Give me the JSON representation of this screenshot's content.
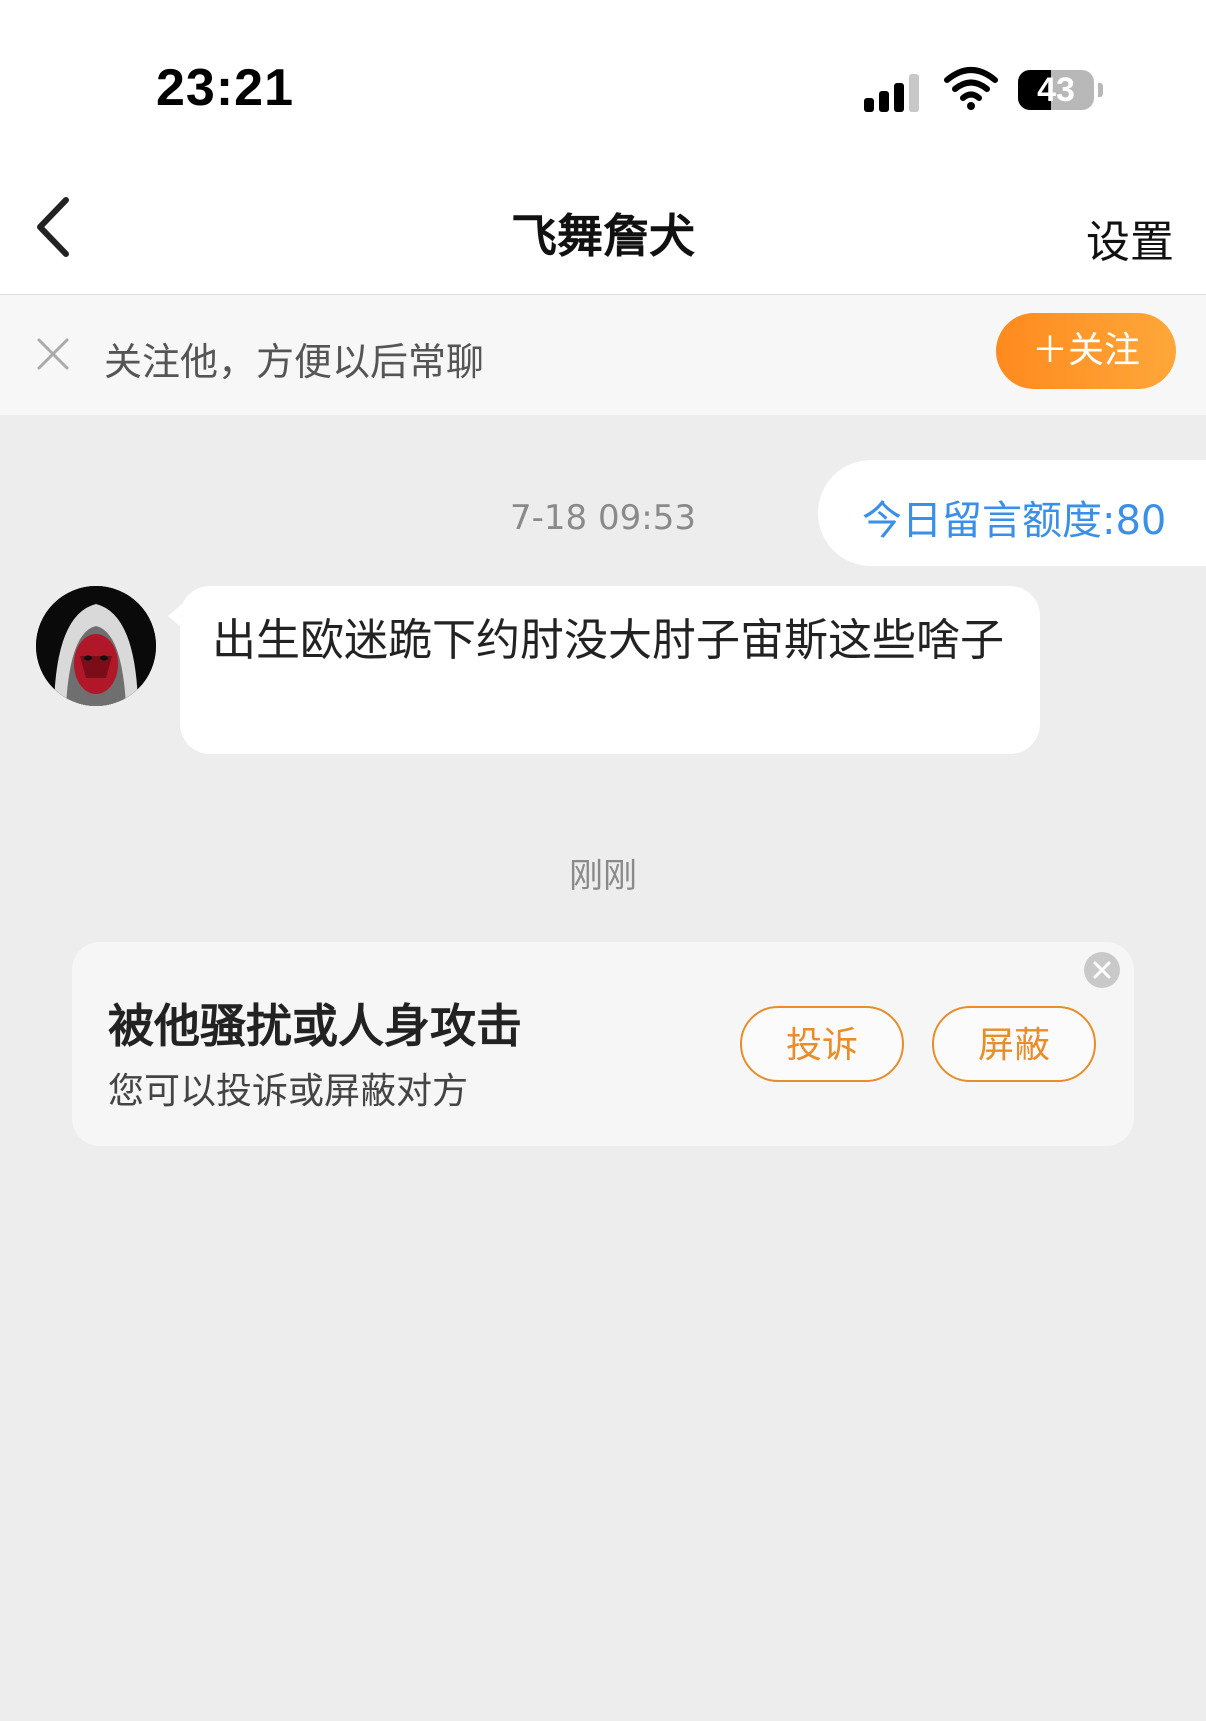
{
  "status_bar": {
    "time": "23:21",
    "signal_bars": 4,
    "wifi": "wifi-icon",
    "battery_level": "43"
  },
  "header": {
    "back_icon": "chevron-left-icon",
    "title": "飞舞詹犬",
    "settings_label": "设置"
  },
  "follow_bar": {
    "close_icon": "close-icon",
    "text": "关注他，方便以后常聊",
    "button_label": "＋关注",
    "accent_color": "#ff9a2e"
  },
  "messages": [
    {
      "timestamp": "7-18 09:53",
      "text": "出生欧迷跪下约肘没大肘子宙斯这些啥子",
      "avatar": "hooded-figure-avatar"
    }
  ],
  "quota_badge": "今日留言额度:80",
  "recent_time": "刚刚",
  "report_card": {
    "title": "被他骚扰或人身攻击",
    "subtitle": "您可以投诉或屏蔽对方",
    "complain_label": "投诉",
    "block_label": "屏蔽",
    "close_icon": "close-icon",
    "accent_color": "#e88d2a"
  },
  "colors": {
    "background": "#ededed",
    "link_blue": "#3a8fe8"
  }
}
